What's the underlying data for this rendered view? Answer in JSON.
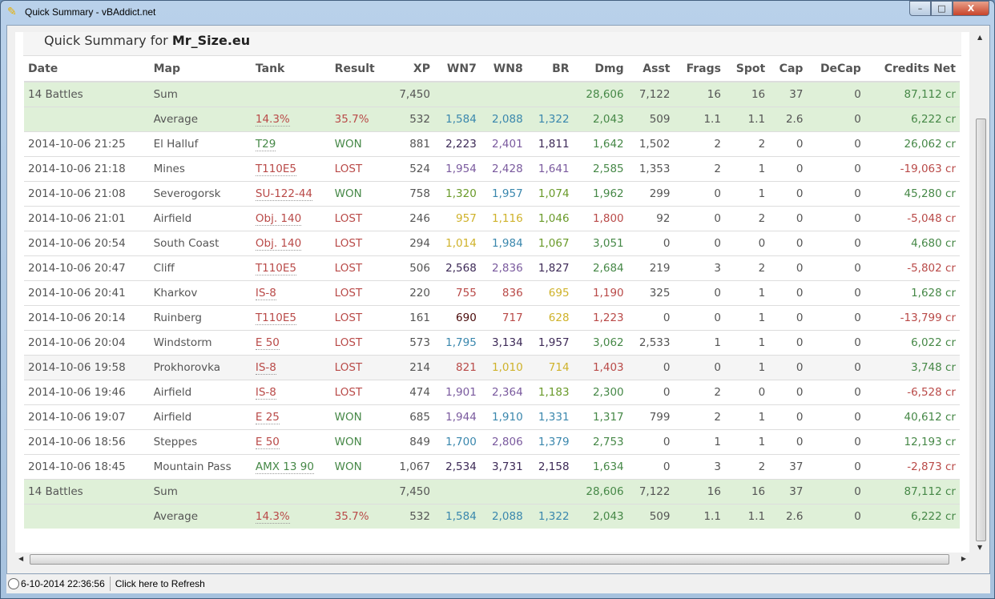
{
  "window": {
    "title": "Quick Summary - vBAddict.net",
    "min": "–",
    "max": "□",
    "close": "X"
  },
  "heading": {
    "prefix": "Quick Summary for",
    "player": "Mr_Size.eu"
  },
  "columns": [
    "Date",
    "Map",
    "Tank",
    "Result",
    "XP",
    "WN7",
    "WN8",
    "BR",
    "Dmg",
    "Asst",
    "Frags",
    "Spot",
    "Cap",
    "DeCap",
    "Credits Net"
  ],
  "summary": {
    "sum": {
      "date": "14 Battles",
      "map": "Sum",
      "xp": "7,450",
      "dmg": "28,606",
      "asst": "7,122",
      "frags": "16",
      "spot": "16",
      "cap": "37",
      "decap": "0",
      "credits": "87,112 cr"
    },
    "avg": {
      "map": "Average",
      "tank": "14.3%",
      "result": "35.7%",
      "xp": "532",
      "wn7": "1,584",
      "wn8": "2,088",
      "br": "1,322",
      "dmg": "2,043",
      "asst": "509",
      "frags": "1.1",
      "spot": "1.1",
      "cap": "2.6",
      "decap": "0",
      "credits": "6,222 cr"
    }
  },
  "rows": [
    [
      "2014-10-06 21:25",
      "El Halluf",
      "T29",
      "WON",
      "881",
      "2,223",
      "2,401",
      "1,811",
      "1,642",
      "1,502",
      "2",
      "2",
      "0",
      "0",
      "26,062 cr"
    ],
    [
      "2014-10-06 21:18",
      "Mines",
      "T110E5",
      "LOST",
      "524",
      "1,954",
      "2,428",
      "1,641",
      "2,585",
      "1,353",
      "2",
      "1",
      "0",
      "0",
      "-19,063 cr"
    ],
    [
      "2014-10-06 21:08",
      "Severogorsk",
      "SU-122-44",
      "WON",
      "758",
      "1,320",
      "1,957",
      "1,074",
      "1,962",
      "299",
      "0",
      "1",
      "0",
      "0",
      "45,280 cr"
    ],
    [
      "2014-10-06 21:01",
      "Airfield",
      "Obj. 140",
      "LOST",
      "246",
      "957",
      "1,116",
      "1,046",
      "1,800",
      "92",
      "0",
      "2",
      "0",
      "0",
      "-5,048 cr"
    ],
    [
      "2014-10-06 20:54",
      "South Coast",
      "Obj. 140",
      "LOST",
      "294",
      "1,014",
      "1,984",
      "1,067",
      "3,051",
      "0",
      "0",
      "0",
      "0",
      "0",
      "4,680 cr"
    ],
    [
      "2014-10-06 20:47",
      "Cliff",
      "T110E5",
      "LOST",
      "506",
      "2,568",
      "2,836",
      "1,827",
      "2,684",
      "219",
      "3",
      "2",
      "0",
      "0",
      "-5,802 cr"
    ],
    [
      "2014-10-06 20:41",
      "Kharkov",
      "IS-8",
      "LOST",
      "220",
      "755",
      "836",
      "695",
      "1,190",
      "325",
      "0",
      "1",
      "0",
      "0",
      "1,628 cr"
    ],
    [
      "2014-10-06 20:14",
      "Ruinberg",
      "T110E5",
      "LOST",
      "161",
      "690",
      "717",
      "628",
      "1,223",
      "0",
      "0",
      "1",
      "0",
      "0",
      "-13,799 cr"
    ],
    [
      "2014-10-06 20:04",
      "Windstorm",
      "E 50",
      "LOST",
      "573",
      "1,795",
      "3,134",
      "1,957",
      "3,062",
      "2,533",
      "1",
      "1",
      "0",
      "0",
      "6,022 cr"
    ],
    [
      "2014-10-06 19:58",
      "Prokhorovka",
      "IS-8",
      "LOST",
      "214",
      "821",
      "1,010",
      "714",
      "1,403",
      "0",
      "0",
      "1",
      "0",
      "0",
      "3,748 cr"
    ],
    [
      "2014-10-06 19:46",
      "Airfield",
      "IS-8",
      "LOST",
      "474",
      "1,901",
      "2,364",
      "1,183",
      "2,300",
      "0",
      "2",
      "0",
      "0",
      "0",
      "-6,528 cr"
    ],
    [
      "2014-10-06 19:07",
      "Airfield",
      "E 25",
      "WON",
      "685",
      "1,944",
      "1,910",
      "1,331",
      "1,317",
      "799",
      "2",
      "1",
      "0",
      "0",
      "40,612 cr"
    ],
    [
      "2014-10-06 18:56",
      "Steppes",
      "E 50",
      "WON",
      "849",
      "1,700",
      "2,806",
      "1,379",
      "2,753",
      "0",
      "1",
      "1",
      "0",
      "0",
      "12,193 cr"
    ],
    [
      "2014-10-06 18:45",
      "Mountain Pass",
      "AMX 13 90",
      "WON",
      "1,067",
      "2,534",
      "3,731",
      "2,158",
      "1,634",
      "0",
      "3",
      "2",
      "37",
      "0",
      "-2,873 cr"
    ]
  ],
  "row_colors": [
    [
      "green",
      "green",
      "dpurple",
      "purple",
      "dpurple",
      "green",
      "green"
    ],
    [
      "red",
      "red",
      "purple",
      "purple",
      "purple",
      "green",
      "red"
    ],
    [
      "red",
      "green",
      "lgreen",
      "blue",
      "lgreen",
      "green",
      "green"
    ],
    [
      "red",
      "red",
      "yellow",
      "yellow",
      "lgreen",
      "red",
      "red"
    ],
    [
      "red",
      "red",
      "yellow",
      "blue",
      "lgreen",
      "green",
      "green"
    ],
    [
      "red",
      "red",
      "dpurple",
      "purple",
      "dpurple",
      "green",
      "red"
    ],
    [
      "red",
      "red",
      "red",
      "red",
      "yellow",
      "red",
      "green"
    ],
    [
      "red",
      "red",
      "darkred",
      "red",
      "yellow",
      "red",
      "red"
    ],
    [
      "red",
      "red",
      "blue",
      "dpurple",
      "dpurple",
      "green",
      "green"
    ],
    [
      "red",
      "red",
      "red",
      "yellow",
      "yellow",
      "red",
      "green"
    ],
    [
      "red",
      "red",
      "purple",
      "purple",
      "lgreen",
      "green",
      "red"
    ],
    [
      "red",
      "green",
      "purple",
      "blue",
      "blue",
      "green",
      "green"
    ],
    [
      "red",
      "green",
      "blue",
      "purple",
      "blue",
      "green",
      "green"
    ],
    [
      "green",
      "green",
      "dpurple",
      "dpurple",
      "dpurple",
      "green",
      "red"
    ]
  ],
  "status": {
    "timestamp": "6-10-2014 22:36:56",
    "refresh": "Click here to Refresh"
  }
}
